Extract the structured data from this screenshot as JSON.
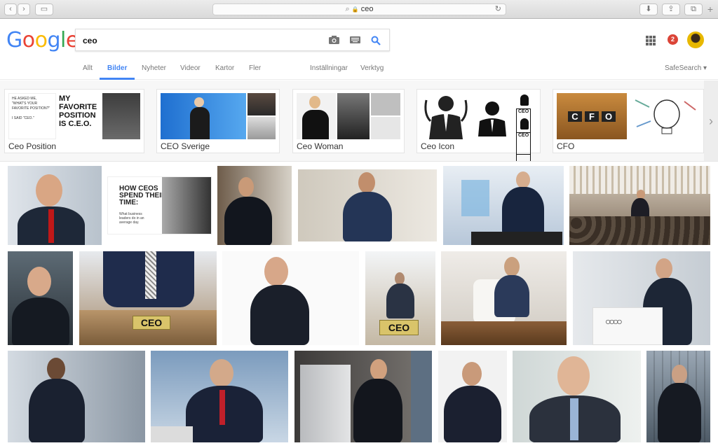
{
  "browser": {
    "url": "ceo",
    "back_glyph": "‹",
    "forward_glyph": "›",
    "sidebar_glyph": "▭",
    "reload_glyph": "↻",
    "lock_glyph": "🔒",
    "download_glyph": "⬇",
    "share_glyph": "⇪",
    "tabs_glyph": "⧉",
    "new_tab_glyph": "+"
  },
  "logo": {
    "letters": [
      "G",
      "o",
      "o",
      "g",
      "l",
      "e"
    ],
    "colors": [
      "#4285f4",
      "#ea4335",
      "#fbbc05",
      "#4285f4",
      "#34a853",
      "#ea4335"
    ]
  },
  "search": {
    "value": "ceo"
  },
  "nav_tabs": [
    {
      "label": "Allt"
    },
    {
      "label": "Bilder"
    },
    {
      "label": "Nyheter"
    },
    {
      "label": "Videor"
    },
    {
      "label": "Kartor"
    },
    {
      "label": "Fler"
    }
  ],
  "tools": {
    "settings": "Inställningar",
    "tools": "Verktyg",
    "safesearch": "SafeSearch ▾"
  },
  "account": {
    "notifications": "2"
  },
  "related": [
    {
      "label": "Ceo Position",
      "thumb_text": "MY FAVORITE POSITION IS C.E.O."
    },
    {
      "label": "CEO Sverige"
    },
    {
      "label": "Ceo Woman"
    },
    {
      "label": "Ceo Icon",
      "icon_text": "CEO"
    },
    {
      "label": "CFO",
      "tiles": [
        "C",
        "F",
        "O"
      ]
    }
  ],
  "overlay_text": {
    "how_ceos": "HOW CEOS SPEND THEIR TIME:",
    "how_ceos_sub": "What business leaders do in an average day.",
    "plate": "CEO"
  },
  "colors": {
    "accent": "#4285f4",
    "badge": "#db4437"
  }
}
